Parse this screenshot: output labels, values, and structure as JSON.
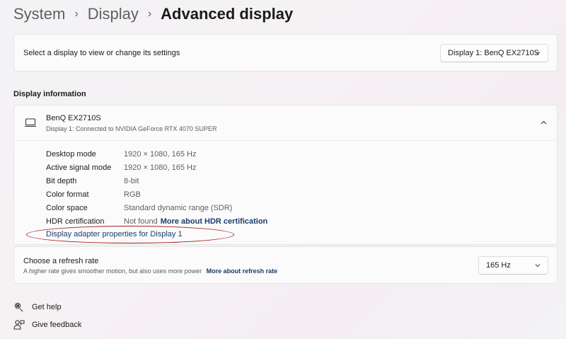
{
  "breadcrumb": {
    "items": [
      "System",
      "Display"
    ],
    "current": "Advanced display"
  },
  "select_display": {
    "label": "Select a display to view or change its settings",
    "dropdown_value": "Display 1: BenQ EX2710S"
  },
  "display_info": {
    "section_title": "Display information",
    "monitor_name": "BenQ EX2710S",
    "monitor_sub": "Display 1: Connected to NVIDIA GeForce RTX 4070 SUPER",
    "rows": [
      {
        "key": "Desktop mode",
        "value": "1920 × 1080, 165 Hz"
      },
      {
        "key": "Active signal mode",
        "value": "1920 × 1080, 165 Hz"
      },
      {
        "key": "Bit depth",
        "value": "8-bit"
      },
      {
        "key": "Color format",
        "value": "RGB"
      },
      {
        "key": "Color space",
        "value": "Standard dynamic range (SDR)"
      },
      {
        "key": "HDR certification",
        "value": "Not found",
        "link": "More about HDR certification"
      }
    ],
    "adapter_link": "Display adapter properties for Display 1"
  },
  "refresh_rate": {
    "title": "Choose a refresh rate",
    "subtitle": "A higher rate gives smoother motion, but also uses more power",
    "link": "More about refresh rate",
    "dropdown_value": "165 Hz"
  },
  "footer": {
    "help": "Get help",
    "feedback": "Give feedback"
  },
  "colors": {
    "link": "#1a3d6b",
    "annotation_circle": "#a61e1e"
  }
}
